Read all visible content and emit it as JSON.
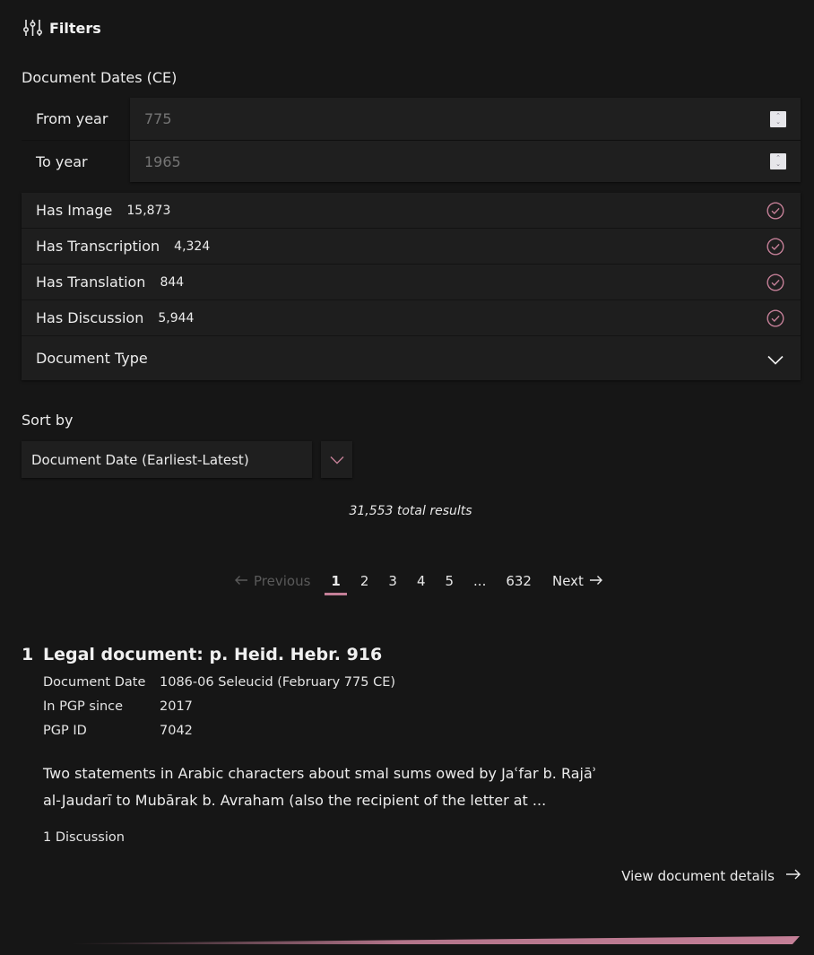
{
  "filters": {
    "heading": "Filters",
    "heading_icon": "sliders-icon",
    "dates": {
      "label": "Document Dates (CE)",
      "from": {
        "label": "From year",
        "value": "775"
      },
      "to": {
        "label": "To year",
        "value": "1965"
      }
    },
    "checkboxes": [
      {
        "label": "Has Image",
        "count": "15,873",
        "checked": true
      },
      {
        "label": "Has Transcription",
        "count": "4,324",
        "checked": true
      },
      {
        "label": "Has Translation",
        "count": "844",
        "checked": true
      },
      {
        "label": "Has Discussion",
        "count": "5,944",
        "checked": true
      }
    ],
    "document_type": {
      "label": "Document Type",
      "icon": "chevron-down-icon"
    }
  },
  "sort": {
    "label": "Sort by",
    "selected": "Document Date (Earliest-Latest)"
  },
  "results": {
    "total": "31,553 total results"
  },
  "pagination": {
    "previous": "Previous",
    "pages": [
      "1",
      "2",
      "3",
      "4",
      "5"
    ],
    "current": "1",
    "ellipsis": "...",
    "last": "632",
    "next": "Next"
  },
  "result_items": [
    {
      "number": "1",
      "type": "Legal document:",
      "shelfmark": "p. Heid. Hebr. 916",
      "meta": [
        {
          "key": "Document Date",
          "value": "1086-06 Seleucid (February 775 CE)"
        },
        {
          "key": "In PGP since",
          "value": "2017"
        },
        {
          "key": "PGP ID",
          "value": "7042"
        }
      ],
      "description": "Two statements in Arabic characters about smal sums owed by Jaʿfar b. Rajāʾ al-Jaudarī to Mubārak b. Avraham (also the recipient of the letter at ...",
      "discussion": "1 Discussion",
      "view_details": "View document details"
    }
  ],
  "colors": {
    "background": "#161616",
    "panel": "#1f1f1f",
    "accent": "#c47f97",
    "text": "#ececec",
    "muted": "#5a5a5a"
  }
}
